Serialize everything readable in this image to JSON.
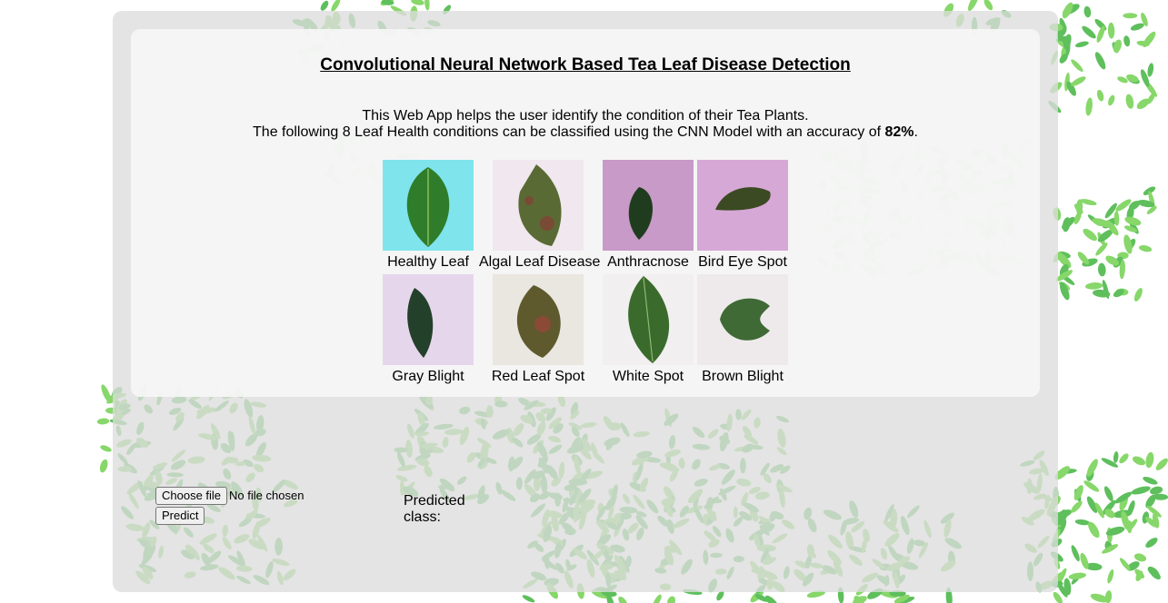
{
  "header": {
    "title": "Convolutional Neural Network Based Tea Leaf Disease Detection"
  },
  "description": {
    "line1": "This Web App helps the user identify the condition of their Tea Plants.",
    "line2_prefix": "The following 8 Leaf Health conditions can be classified using the CNN Model with an accuracy of ",
    "accuracy": "82%",
    "line2_suffix": "."
  },
  "conditions": [
    {
      "label": "Healthy Leaf",
      "icon": "healthy-leaf-image",
      "bg": "#7fe4ec",
      "leaf": "#2f7d2a"
    },
    {
      "label": "Algal Leaf Disease",
      "icon": "algal-leaf-image",
      "bg": "#f0e8ee",
      "leaf": "#5a6a34"
    },
    {
      "label": "Anthracnose",
      "icon": "anthracnose-leaf-image",
      "bg": "#c79ac7",
      "leaf": "#1f3d1e"
    },
    {
      "label": "Bird Eye Spot",
      "icon": "bird-eye-spot-leaf-image",
      "bg": "#d6a8d6",
      "leaf": "#3b4a22"
    },
    {
      "label": "Gray Blight",
      "icon": "gray-blight-leaf-image",
      "bg": "#e6d6ec",
      "leaf": "#23402a"
    },
    {
      "label": "Red Leaf Spot",
      "icon": "red-leaf-spot-image",
      "bg": "#eae6e0",
      "leaf": "#5e5a2e"
    },
    {
      "label": "White Spot",
      "icon": "white-spot-leaf-image",
      "bg": "#f2eff0",
      "leaf": "#3a6b2c"
    },
    {
      "label": "Brown Blight",
      "icon": "brown-blight-leaf-image",
      "bg": "#eeeaec",
      "leaf": "#3f6a35"
    }
  ],
  "upload": {
    "choose_label": "Choose file",
    "file_status": "No file chosen",
    "predict_label": "Predict"
  },
  "result": {
    "label": "Predicted class:"
  },
  "colors": {
    "leaf_green": "#4cb84a",
    "panel_outer": "#dcdcdc",
    "panel_inner": "#f6f6f6"
  }
}
